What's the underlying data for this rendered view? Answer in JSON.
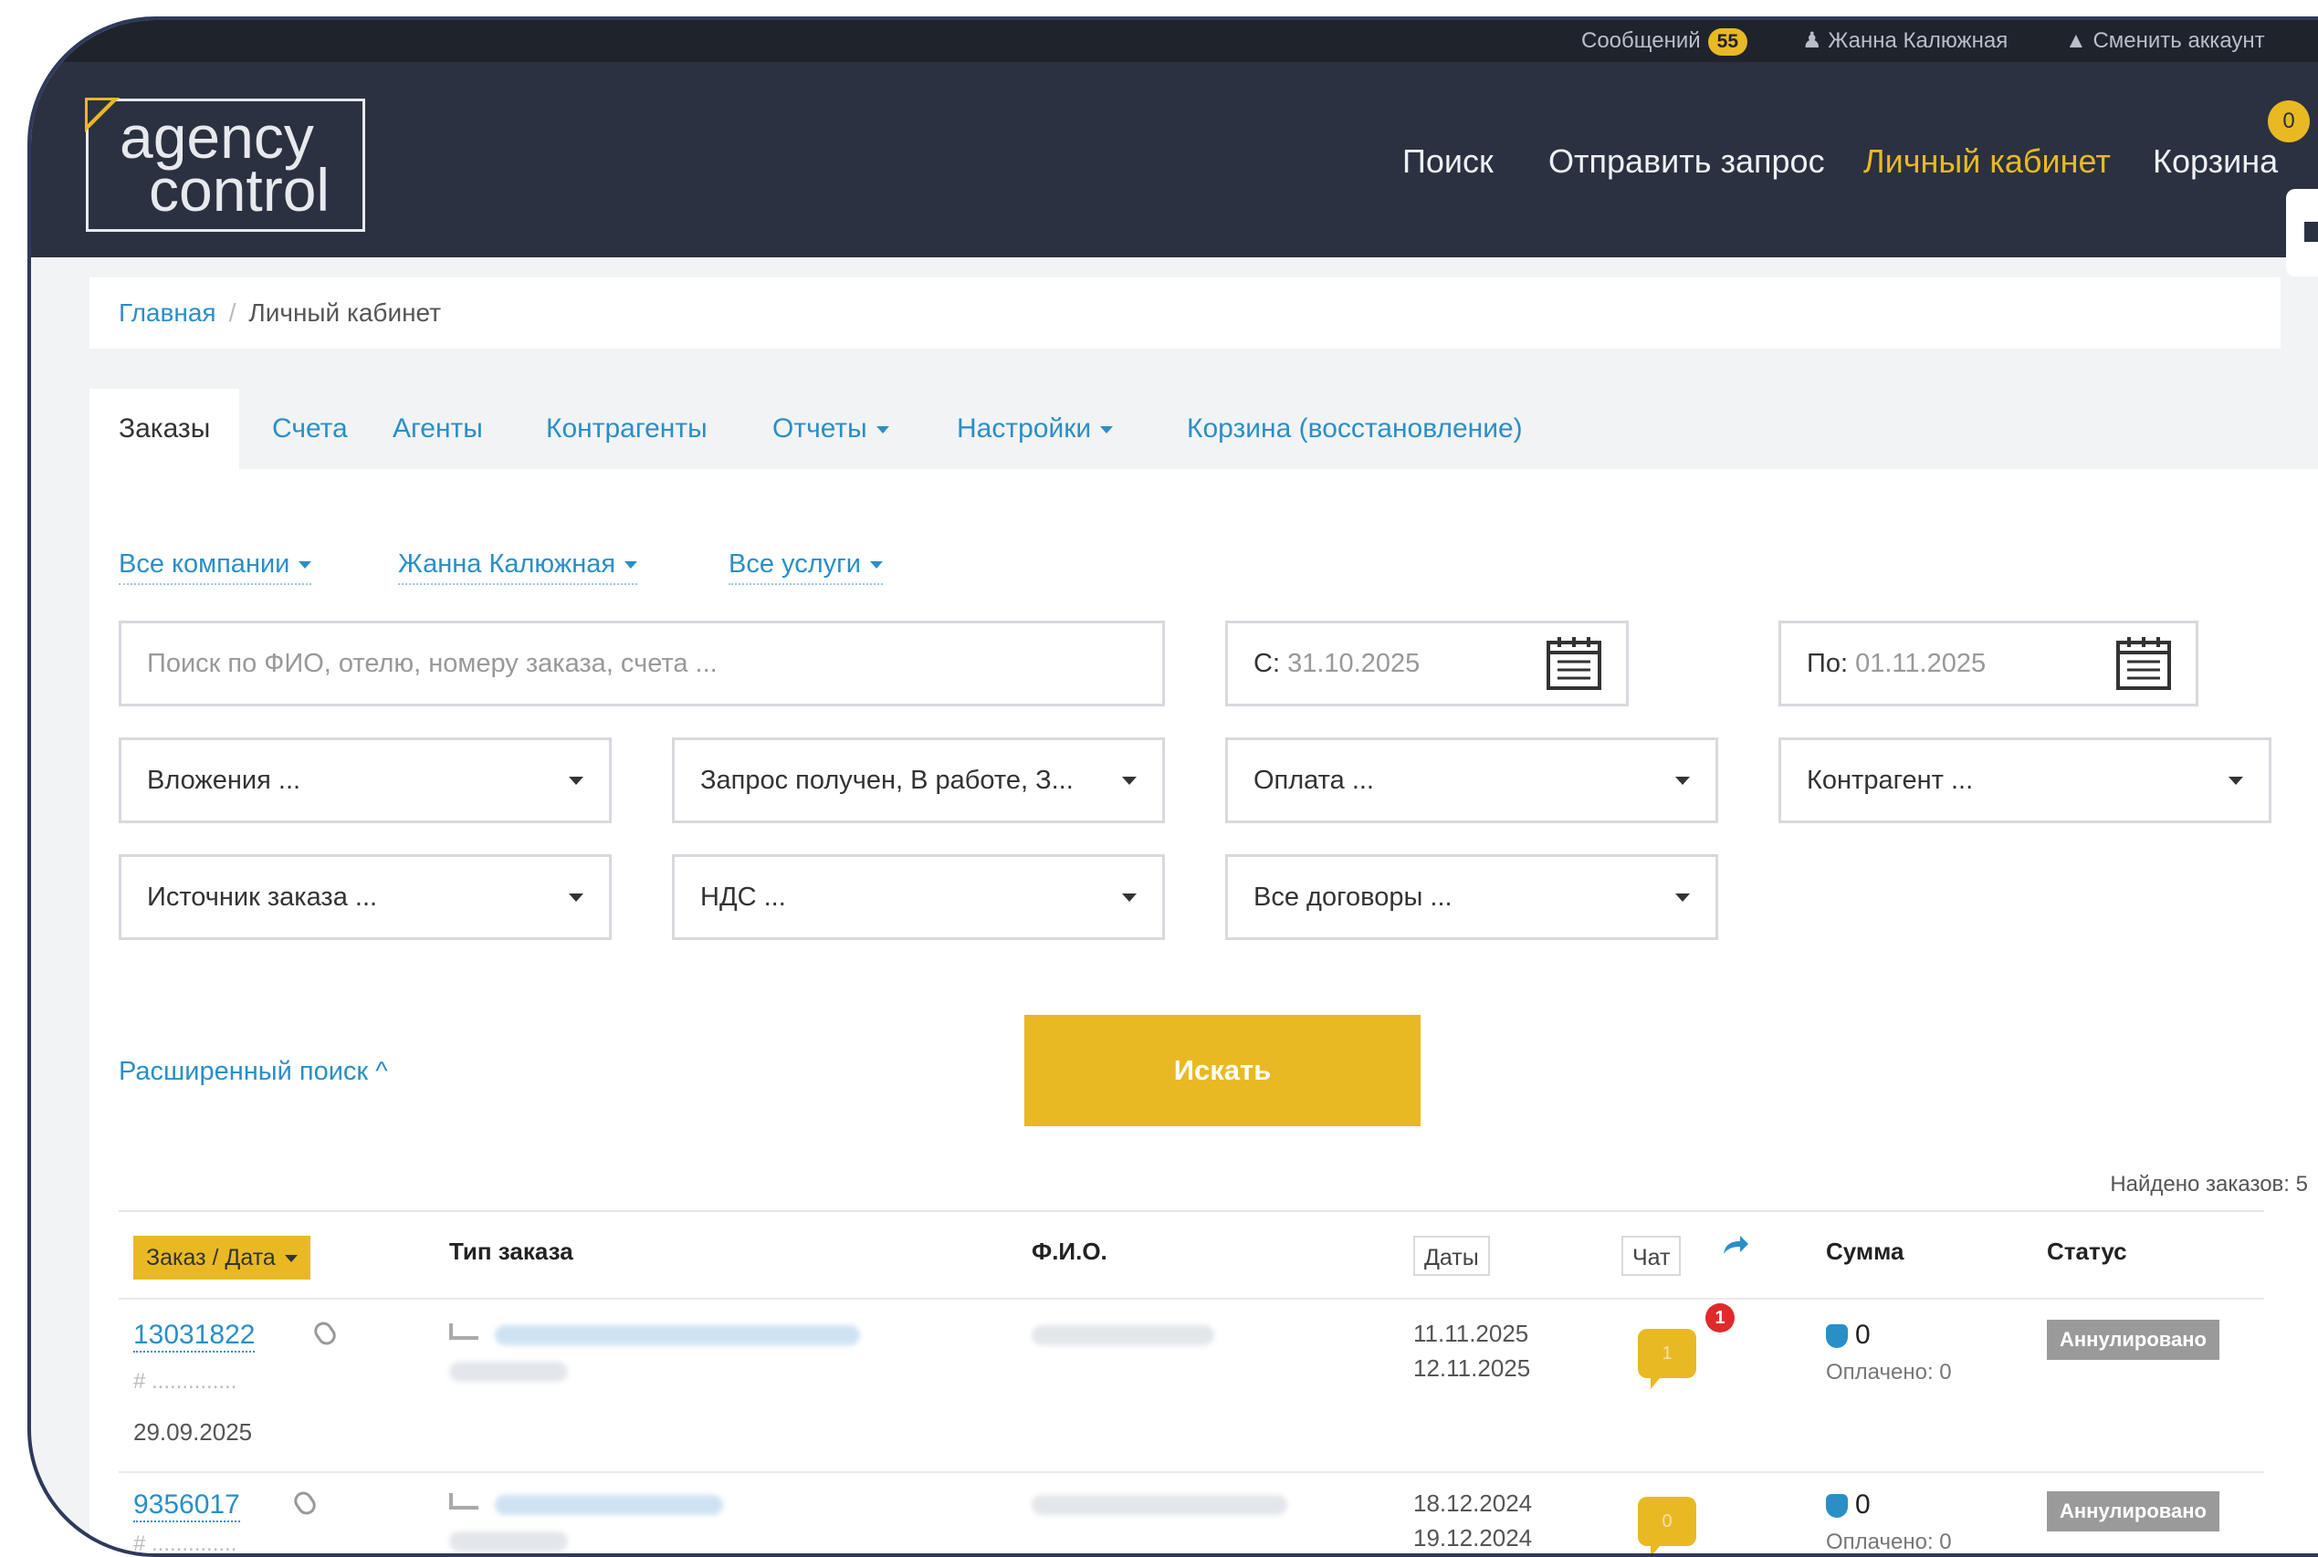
{
  "topbar": {
    "messages_label": "Сообщений",
    "messages_count": "55",
    "user_name": "Жанна Калюжная",
    "switch_account": "Сменить аккаунт"
  },
  "header": {
    "logo_line1": "agency",
    "logo_line2": "control",
    "nav": {
      "search": "Поиск",
      "send_request": "Отправить запрос",
      "cabinet": "Личный кабинет",
      "cart": "Корзина"
    },
    "cart_count": "0"
  },
  "breadcrumb": {
    "home": "Главная",
    "separator": "/",
    "current": "Личный кабинет"
  },
  "tabs": {
    "orders": "Заказы",
    "invoices": "Счета",
    "agents": "Агенты",
    "contractors": "Контрагенты",
    "reports": "Отчеты",
    "settings": "Настройки",
    "trash": "Корзина (восстановление)"
  },
  "filters": {
    "companies": "Все компании",
    "user": "Жанна Калюжная",
    "services": "Все услуги"
  },
  "search": {
    "placeholder": "Поиск по ФИО, отелю, номеру заказа, счета ...",
    "from_label": "С:",
    "from_value": "31.10.2025",
    "to_label": "По:",
    "to_value": "01.11.2025"
  },
  "selects": {
    "attachments": "Вложения ...",
    "status": "Запрос получен, В работе, З...",
    "payment": "Оплата ...",
    "contractor": "Контрагент ...",
    "source": "Источник заказа ...",
    "vat": "НДС ...",
    "contracts": "Все договоры ..."
  },
  "advanced_search": "Расширенный поиск ^",
  "search_button": "Искать",
  "found_text": "Найдено заказов: 5",
  "table": {
    "headers": {
      "order_date": "Заказ / Дата",
      "order_type": "Тип заказа",
      "fio": "Ф.И.О.",
      "dates": "Даты",
      "chat": "Чат",
      "sum": "Сумма",
      "status": "Статус"
    },
    "rows": [
      {
        "order_no": "13031822",
        "hash": "# ..............",
        "created": "29.09.2025",
        "date_from": "11.11.2025",
        "date_to": "12.11.2025",
        "chat_count": "1",
        "unread": "1",
        "sum": "0",
        "paid": "Оплачено: 0",
        "status": "Аннулировано"
      },
      {
        "order_no": "9356017",
        "hash": "# ..............",
        "created": "",
        "date_from": "18.12.2024",
        "date_to": "19.12.2024",
        "chat_count": "0",
        "unread": "",
        "sum": "0",
        "paid": "Оплачено: 0",
        "status": "Аннулировано"
      }
    ]
  }
}
